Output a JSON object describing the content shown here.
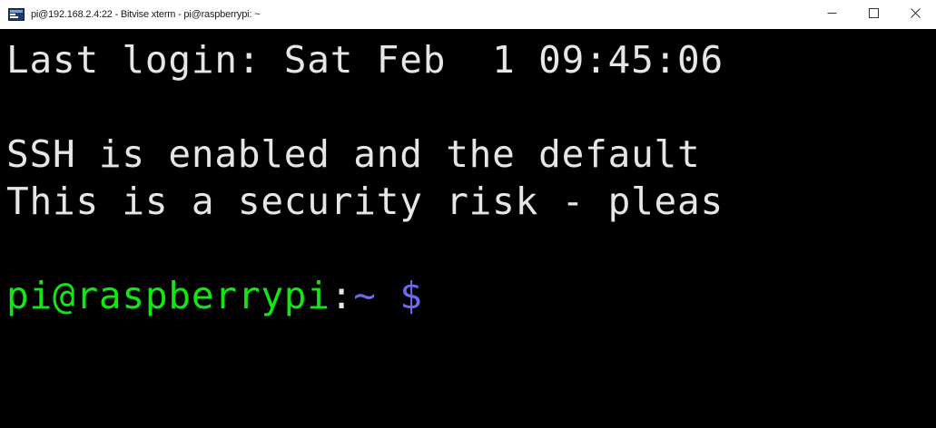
{
  "window": {
    "title": "pi@192.168.2.4:22 - Bitvise xterm - pi@raspberrypi: ~",
    "icon": "terminal-app-icon",
    "controls": {
      "minimize_icon": "minimize-icon",
      "maximize_icon": "maximize-icon",
      "close_icon": "close-icon"
    }
  },
  "terminal": {
    "lines": {
      "last_login": "Last login: Sat Feb  1 09:45:06",
      "blank_1": "",
      "ssh_warning": "SSH is enabled and the default",
      "security_risk": "This is a security risk - pleas",
      "blank_2": ""
    },
    "prompt": {
      "user_host": "pi@raspberrypi",
      "separator": ":",
      "path": "~",
      "symbol": " $"
    },
    "colors": {
      "background": "#000000",
      "foreground": "#e6e6e6",
      "user_host": "#11e811",
      "path": "#6a6af2"
    }
  }
}
